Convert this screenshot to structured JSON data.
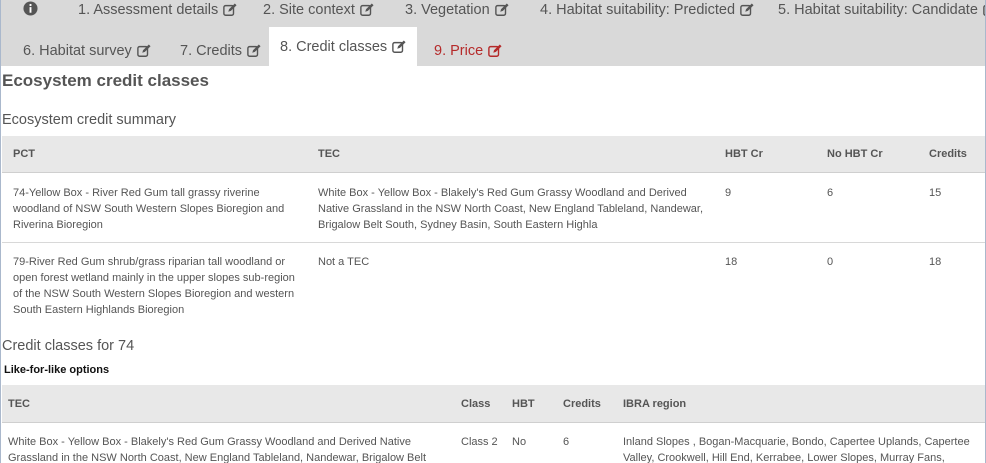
{
  "tabs": [
    {
      "label": "1. Assessment details",
      "icon": "edit-icon"
    },
    {
      "label": "2. Site context",
      "icon": "edit-icon"
    },
    {
      "label": "3. Vegetation",
      "icon": "edit-icon"
    },
    {
      "label": "4. Habitat suitability: Predicted",
      "icon": "edit-icon"
    },
    {
      "label": "5. Habitat suitability: Candidate",
      "icon": "edit-icon"
    },
    {
      "label": "6. Habitat survey",
      "icon": "edit-icon"
    },
    {
      "label": "7. Credits",
      "icon": "edit-icon"
    },
    {
      "label": "8. Credit classes",
      "icon": "edit-icon",
      "active": true
    },
    {
      "label": "9. Price",
      "icon": "edit-icon",
      "color": "#b52a2a"
    }
  ],
  "page_title": "Ecosystem credit classes",
  "summary": {
    "title": "Ecosystem credit summary",
    "headers": [
      "PCT",
      "TEC",
      "HBT Cr",
      "No HBT Cr",
      "Credits"
    ],
    "rows": [
      {
        "pct": "74-Yellow Box - River Red Gum tall grassy riverine woodland of NSW South Western Slopes Bioregion and Riverina Bioregion",
        "tec": "White Box - Yellow Box - Blakely's Red Gum Grassy Woodland and Derived Native Grassland in the NSW North Coast, New England Tableland, Nandewar, Brigalow Belt South, Sydney Basin, South Eastern Highla",
        "hbt": "9",
        "nohbt": "6",
        "credits": "15"
      },
      {
        "pct": "79-River Red Gum shrub/grass riparian tall woodland or open forest wetland mainly in the upper slopes sub-region of the NSW South Western Slopes Bioregion and western South Eastern Highlands Bioregion",
        "tec": "Not a TEC",
        "hbt": "18",
        "nohbt": "0",
        "credits": "18"
      }
    ]
  },
  "classes": {
    "title": "Credit classes for 74",
    "subtitle": "Like-for-like options",
    "headers": [
      "TEC",
      "Class",
      "HBT",
      "Credits",
      "IBRA region"
    ],
    "rows": [
      {
        "tec": "White Box - Yellow Box - Blakely's Red Gum Grassy Woodland and Derived Native Grassland in the NSW North Coast, New England Tableland, Nandewar, Brigalow Belt",
        "class": "Class 2",
        "hbt": "No",
        "credits": "6",
        "ibra": "Inland Slopes , Bogan-Macquarie, Bondo, Capertee Uplands, Capertee Valley, Crookwell, Hill End, Kerrabee, Lower Slopes, Murray Fans,"
      }
    ]
  },
  "colors": {
    "tab_bg": "#d9d9d9",
    "header_bg": "#e8e8e8",
    "alert": "#b52a2a"
  }
}
